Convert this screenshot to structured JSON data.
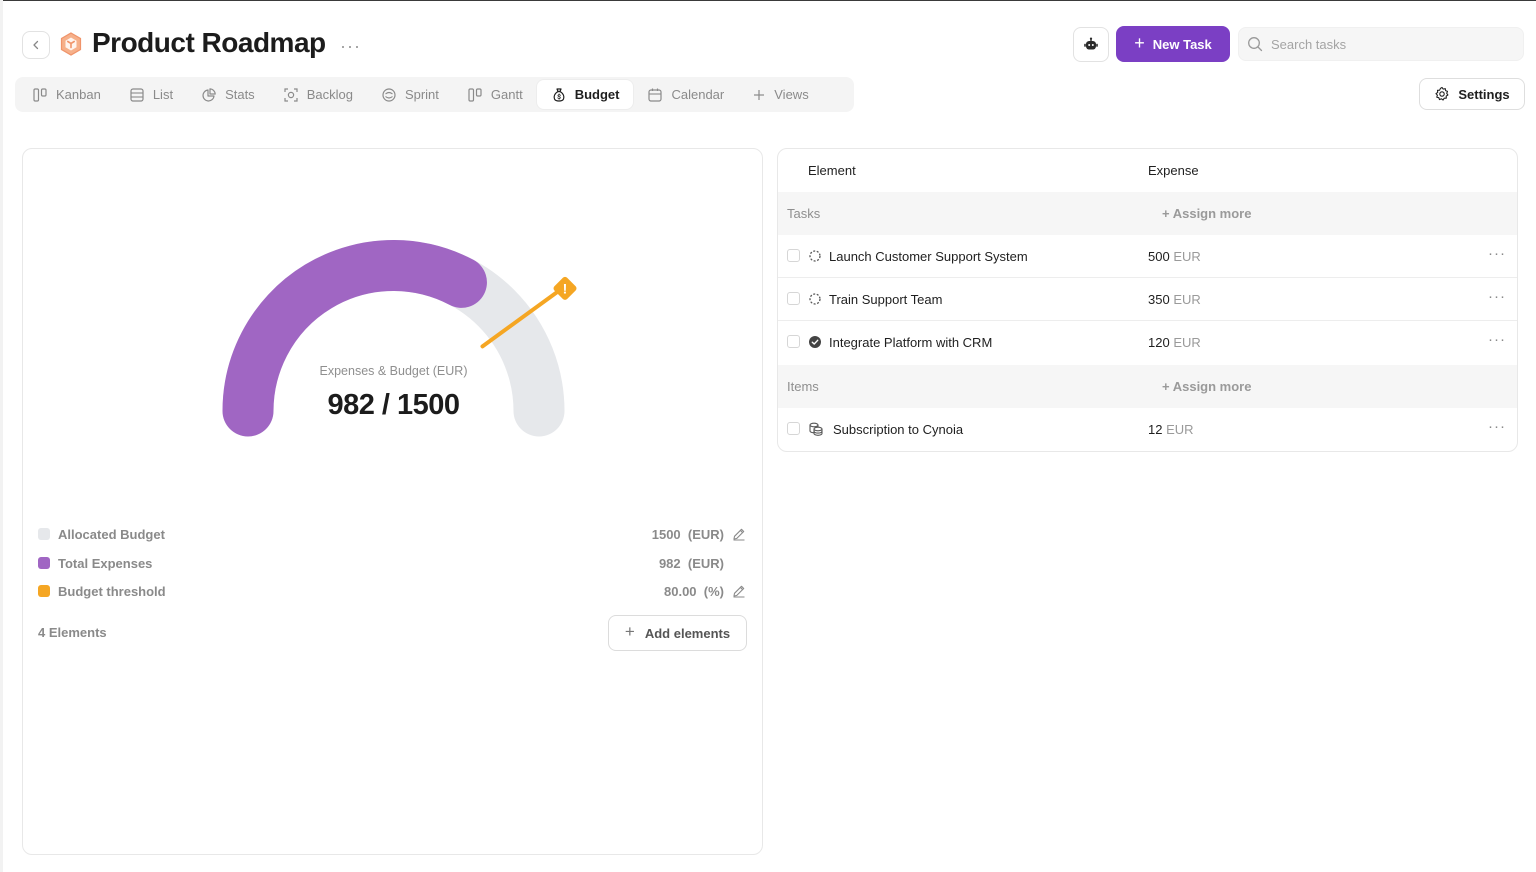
{
  "header": {
    "title": "Product Roadmap",
    "title_more": "···",
    "new_task_label": "New Task",
    "search_placeholder": "Search tasks",
    "settings_label": "Settings"
  },
  "tabs": [
    {
      "label": "Kanban",
      "icon": "kanban-icon"
    },
    {
      "label": "List",
      "icon": "list-icon"
    },
    {
      "label": "Stats",
      "icon": "pie-chart-icon"
    },
    {
      "label": "Backlog",
      "icon": "backlog-icon"
    },
    {
      "label": "Sprint",
      "icon": "sprint-icon"
    },
    {
      "label": "Gantt",
      "icon": "gantt-icon"
    },
    {
      "label": "Budget",
      "icon": "money-bag-icon",
      "active": true
    },
    {
      "label": "Calendar",
      "icon": "calendar-icon"
    },
    {
      "label": "Views",
      "icon": "plus-icon"
    }
  ],
  "budget": {
    "gauge_label": "Expenses & Budget (EUR)",
    "gauge_value": "982 / 1500",
    "allocated": 1500,
    "expenses": 982,
    "threshold_percent": 80,
    "colors": {
      "expenses": "#a066c3",
      "remaining": "#e6e8eb",
      "threshold": "#f5a623",
      "accent": "#7b3fc4"
    },
    "legend": [
      {
        "name": "Allocated Budget",
        "value": "1500",
        "unit": "(EUR)",
        "color": "#e6e8eb",
        "editable": true
      },
      {
        "name": "Total Expenses",
        "value": "982",
        "unit": "(EUR)",
        "color": "#a066c3",
        "editable": false
      },
      {
        "name": "Budget threshold",
        "value": "80.00",
        "unit": "(%)",
        "color": "#f5a623",
        "editable": true
      }
    ],
    "elements_count": "4 Elements",
    "add_elements_label": "Add elements"
  },
  "table": {
    "col_element": "Element",
    "col_expense": "Expense",
    "groups": [
      {
        "name": "Tasks",
        "assign_label": "+ Assign more",
        "rows": [
          {
            "name": "Launch Customer Support System",
            "amount": "500",
            "currency": "EUR",
            "status": "in-progress"
          },
          {
            "name": "Train Support Team",
            "amount": "350",
            "currency": "EUR",
            "status": "in-progress"
          },
          {
            "name": "Integrate Platform with CRM",
            "amount": "120",
            "currency": "EUR",
            "status": "done"
          }
        ]
      },
      {
        "name": "Items",
        "assign_label": "+ Assign more",
        "rows": [
          {
            "name": "Subscription to Cynoia",
            "amount": "12",
            "currency": "EUR",
            "status": "item"
          }
        ]
      }
    ]
  }
}
